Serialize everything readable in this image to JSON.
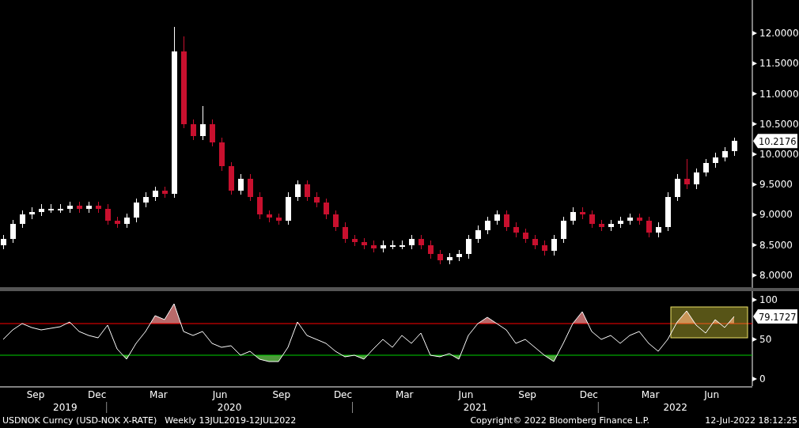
{
  "price_panel": {
    "last_value": "10.2176",
    "chart_data": {
      "type": "candlestick",
      "categories": [
        null,
        null,
        null,
        null,
        null,
        null,
        null,
        null,
        null,
        null,
        null,
        null,
        null,
        null,
        null,
        null,
        null,
        null,
        null,
        null,
        null,
        null,
        null,
        null,
        null,
        null,
        null,
        null,
        null,
        null,
        null,
        null,
        null,
        null,
        null,
        null,
        null,
        null,
        null,
        null,
        null,
        null,
        null,
        null,
        null,
        null,
        null,
        null,
        null,
        null,
        null,
        null,
        null,
        null,
        null,
        null,
        null,
        null,
        null,
        null,
        null,
        null,
        null,
        null,
        null,
        null,
        null,
        null,
        null,
        null,
        null,
        null,
        null,
        null,
        null,
        null,
        null,
        null
      ],
      "ylim": [
        7.79,
        12.55
      ],
      "yticks": [
        {
          "value": 8,
          "label": "8.0000"
        },
        {
          "value": 8.5,
          "label": "8.5000"
        },
        {
          "value": 9,
          "label": "9.0000"
        },
        {
          "value": 9.5,
          "label": "9.5000"
        },
        {
          "value": 10,
          "label": "10.0000"
        },
        {
          "value": 10.5,
          "label": "10.5000"
        },
        {
          "value": 11,
          "label": "11.0000"
        },
        {
          "value": 11.5,
          "label": "11.5000"
        },
        {
          "value": 12,
          "label": "12.0000"
        }
      ],
      "ohlc": [
        [
          8.5,
          8.67,
          8.43,
          8.6
        ],
        [
          8.6,
          8.92,
          8.53,
          8.85
        ],
        [
          8.85,
          9.07,
          8.78,
          9.0
        ],
        [
          9.0,
          9.12,
          8.93,
          9.05
        ],
        [
          9.05,
          9.17,
          8.98,
          9.1
        ],
        [
          9.1,
          9.17,
          9.03,
          9.1
        ],
        [
          9.1,
          9.17,
          9.03,
          9.1
        ],
        [
          9.1,
          9.22,
          9.03,
          9.15
        ],
        [
          9.15,
          9.22,
          9.03,
          9.1
        ],
        [
          9.1,
          9.22,
          9.03,
          9.15
        ],
        [
          9.15,
          9.22,
          9.03,
          9.1
        ],
        [
          9.1,
          9.17,
          8.83,
          8.9
        ],
        [
          8.9,
          8.97,
          8.78,
          8.85
        ],
        [
          8.85,
          9.02,
          8.78,
          8.95
        ],
        [
          8.95,
          9.27,
          8.88,
          9.2
        ],
        [
          9.2,
          9.37,
          9.13,
          9.3
        ],
        [
          9.3,
          9.47,
          9.23,
          9.4
        ],
        [
          9.4,
          9.47,
          9.28,
          9.35
        ],
        [
          9.35,
          12.1,
          9.28,
          11.7
        ],
        [
          11.7,
          11.95,
          10.43,
          10.5
        ],
        [
          10.5,
          10.57,
          10.23,
          10.3
        ],
        [
          10.3,
          10.8,
          10.23,
          10.5
        ],
        [
          10.5,
          10.57,
          10.13,
          10.2
        ],
        [
          10.2,
          10.27,
          9.73,
          9.8
        ],
        [
          9.8,
          9.87,
          9.33,
          9.4
        ],
        [
          9.4,
          9.67,
          9.33,
          9.6
        ],
        [
          9.6,
          9.67,
          9.23,
          9.3
        ],
        [
          9.3,
          9.37,
          8.93,
          9.0
        ],
        [
          9.0,
          9.07,
          8.88,
          8.95
        ],
        [
          8.95,
          9.02,
          8.83,
          8.9
        ],
        [
          8.9,
          9.37,
          8.83,
          9.3
        ],
        [
          9.3,
          9.57,
          9.23,
          9.5
        ],
        [
          9.5,
          9.57,
          9.23,
          9.3
        ],
        [
          9.3,
          9.37,
          9.13,
          9.2
        ],
        [
          9.2,
          9.27,
          8.93,
          9.0
        ],
        [
          9.0,
          9.07,
          8.73,
          8.8
        ],
        [
          8.8,
          8.87,
          8.53,
          8.6
        ],
        [
          8.6,
          8.67,
          8.48,
          8.55
        ],
        [
          8.55,
          8.62,
          8.43,
          8.5
        ],
        [
          8.5,
          8.57,
          8.38,
          8.45
        ],
        [
          8.45,
          8.57,
          8.38,
          8.5
        ],
        [
          8.5,
          8.57,
          8.43,
          8.5
        ],
        [
          8.5,
          8.57,
          8.43,
          8.5
        ],
        [
          8.5,
          8.67,
          8.43,
          8.6
        ],
        [
          8.6,
          8.67,
          8.43,
          8.5
        ],
        [
          8.5,
          8.57,
          8.28,
          8.35
        ],
        [
          8.35,
          8.42,
          8.18,
          8.25
        ],
        [
          8.25,
          8.37,
          8.18,
          8.3
        ],
        [
          8.3,
          8.42,
          8.23,
          8.35
        ],
        [
          8.35,
          8.67,
          8.28,
          8.6
        ],
        [
          8.6,
          8.82,
          8.53,
          8.75
        ],
        [
          8.75,
          8.97,
          8.68,
          8.9
        ],
        [
          8.9,
          9.07,
          8.83,
          9.0
        ],
        [
          9.0,
          9.07,
          8.73,
          8.8
        ],
        [
          8.8,
          8.87,
          8.63,
          8.7
        ],
        [
          8.7,
          8.77,
          8.53,
          8.6
        ],
        [
          8.6,
          8.67,
          8.43,
          8.5
        ],
        [
          8.5,
          8.57,
          8.33,
          8.4
        ],
        [
          8.4,
          8.67,
          8.33,
          8.6
        ],
        [
          8.6,
          8.97,
          8.53,
          8.9
        ],
        [
          8.9,
          9.12,
          8.83,
          9.05
        ],
        [
          9.05,
          9.12,
          8.93,
          9.0
        ],
        [
          9.0,
          9.07,
          8.78,
          8.85
        ],
        [
          8.85,
          8.92,
          8.73,
          8.8
        ],
        [
          8.8,
          8.92,
          8.73,
          8.85
        ],
        [
          8.85,
          8.97,
          8.78,
          8.9
        ],
        [
          8.9,
          9.02,
          8.83,
          8.95
        ],
        [
          8.95,
          9.02,
          8.83,
          8.9
        ],
        [
          8.9,
          8.97,
          8.63,
          8.7
        ],
        [
          8.7,
          8.87,
          8.63,
          8.8
        ],
        [
          8.8,
          9.37,
          8.73,
          9.3
        ],
        [
          9.3,
          9.67,
          9.23,
          9.6
        ],
        [
          9.6,
          9.92,
          9.43,
          9.5
        ],
        [
          9.5,
          9.77,
          9.43,
          9.7
        ],
        [
          9.7,
          9.92,
          9.63,
          9.85
        ],
        [
          9.85,
          10.02,
          9.78,
          9.95
        ],
        [
          9.95,
          10.12,
          9.88,
          10.05
        ],
        [
          10.05,
          10.28,
          9.98,
          10.22
        ]
      ]
    }
  },
  "rsi_panel": {
    "last_value": "79.1727",
    "chart_data": {
      "type": "line",
      "categories": [
        null,
        null,
        null,
        null,
        null,
        null,
        null,
        null,
        null,
        null,
        null,
        null,
        null,
        null,
        null,
        null,
        null,
        null,
        null,
        null,
        null,
        null,
        null,
        null,
        null,
        null,
        null,
        null,
        null,
        null,
        null,
        null,
        null,
        null,
        null,
        null,
        null,
        null,
        null,
        null,
        null,
        null,
        null,
        null,
        null,
        null,
        null,
        null,
        null,
        null,
        null,
        null,
        null,
        null,
        null,
        null,
        null,
        null,
        null,
        null,
        null,
        null,
        null,
        null,
        null,
        null,
        null,
        null,
        null,
        null,
        null,
        null,
        null,
        null,
        null,
        null,
        null,
        null
      ],
      "ylim": [
        -9,
        111
      ],
      "yticks": [
        0,
        50,
        100
      ],
      "series": [
        {
          "color": "#ffffff",
          "values": [
            50,
            62,
            70,
            65,
            62,
            64,
            66,
            72,
            60,
            55,
            52,
            68,
            38,
            25,
            45,
            60,
            80,
            75,
            95,
            60,
            55,
            60,
            45,
            40,
            42,
            30,
            35,
            25,
            22,
            22,
            40,
            72,
            55,
            50,
            45,
            35,
            28,
            30,
            25,
            38,
            50,
            40,
            55,
            45,
            58,
            30,
            28,
            32,
            25,
            55,
            70,
            78,
            70,
            62,
            45,
            50,
            40,
            30,
            22,
            45,
            70,
            85,
            60,
            50,
            55,
            45,
            55,
            60,
            45,
            35,
            50,
            72,
            86,
            68,
            58,
            75,
            65,
            79
          ]
        }
      ],
      "ref_lines": [
        {
          "axis": "y",
          "value": 70,
          "color": "#ff0000"
        },
        {
          "axis": "y",
          "value": 30,
          "color": "#00d000"
        }
      ]
    }
  },
  "x_axis": {
    "months": [
      "Sep",
      "Dec",
      "Mar",
      "Jun",
      "Sep",
      "Dec",
      "Mar",
      "Jun",
      "Sep",
      "Dec",
      "Mar",
      "Jun"
    ],
    "years": [
      "2019",
      "2020",
      "2021",
      "2022"
    ]
  },
  "footer": {
    "security": "USDNOK Curncy (USD-NOK X-RATE)",
    "period": "Weekly 13JUL2019-12JUL2022",
    "copyright": "Copyright© 2022 Bloomberg Finance L.P.",
    "timestamp": "12-Jul-2022 18:12:25"
  }
}
